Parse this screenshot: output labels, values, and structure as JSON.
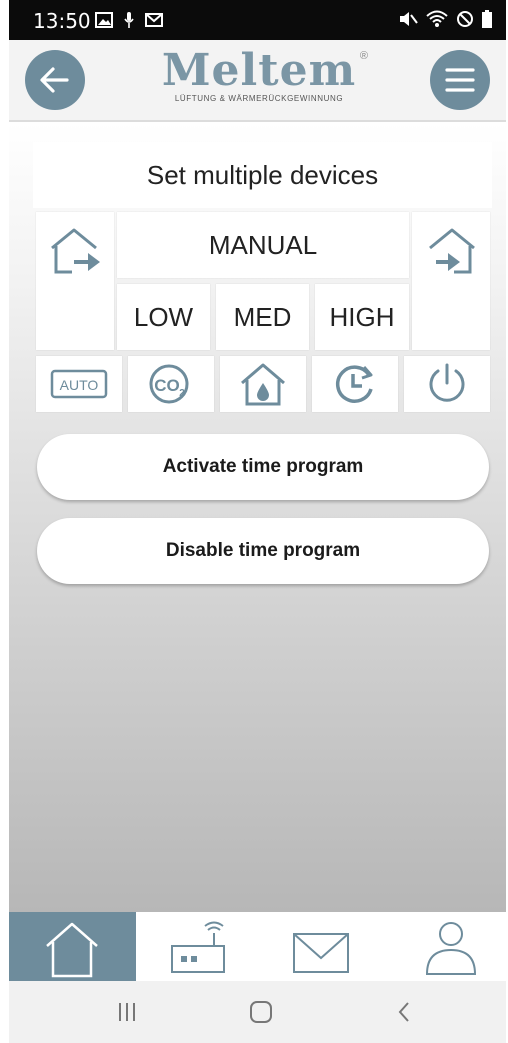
{
  "status_bar": {
    "time": "13:50",
    "left_icons": [
      "image-icon",
      "microphone-icon",
      "mail-icon"
    ],
    "right_icons": [
      "mute-icon",
      "wifi-icon",
      "dnd-icon",
      "battery-icon"
    ]
  },
  "header": {
    "back_icon": "arrow-left-icon",
    "menu_icon": "hamburger-icon",
    "logo_text": "Meltem",
    "logo_tagline": "LÜFTUNG & WÄRMERÜCKGEWINNUNG",
    "logo_registered": "®"
  },
  "panel": {
    "title": "Set multiple devices",
    "left_icon": "house-exhaust-icon",
    "right_icon": "house-supply-icon",
    "mode": "MANUAL",
    "levels": [
      "LOW",
      "MED",
      "HIGH"
    ],
    "modes_icons": [
      "auto-icon",
      "co2-icon",
      "humidity-icon",
      "timer-icon",
      "power-icon"
    ],
    "auto_label": "AUTO",
    "co2_label": "CO",
    "co2_sub": "2"
  },
  "actions": {
    "activate": "Activate time program",
    "disable": "Disable time program"
  },
  "bottom_nav": {
    "tabs": [
      "home-icon",
      "gateway-icon",
      "messages-icon",
      "profile-icon"
    ],
    "active": "home-icon"
  },
  "android_nav": [
    "recents-icon",
    "home-circle-icon",
    "back-chevron-icon"
  ],
  "colors": {
    "accent": "#6e8c9c",
    "logo": "#7b96a5"
  }
}
